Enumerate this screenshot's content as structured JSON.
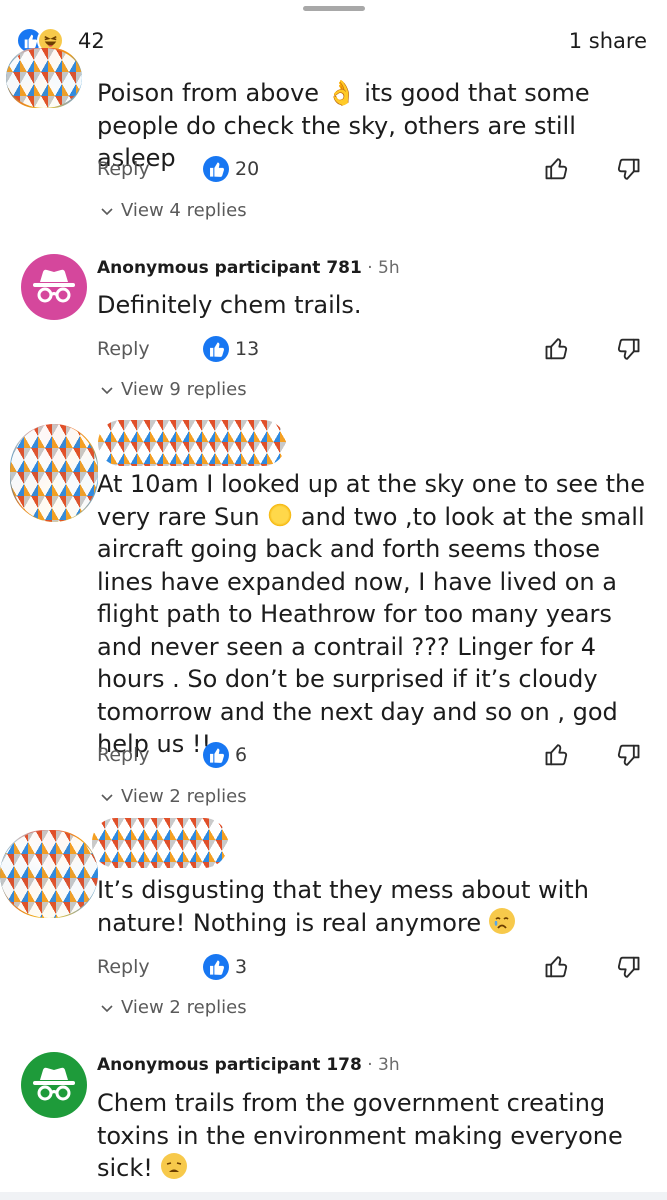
{
  "header": {
    "reaction_count": "42",
    "share_text": "1 share"
  },
  "comments": [
    {
      "body": "Poison from above 👌 its good that some people do check the sky, others are still asleep",
      "reply_label": "Reply",
      "likes": "20",
      "view_replies": "View 4 replies"
    },
    {
      "author": "Anonymous participant 781",
      "time": "· 5h",
      "body": "Definitely chem trails.",
      "reply_label": "Reply",
      "likes": "13",
      "view_replies": "View 9 replies",
      "avatar_color": "#d5479c"
    },
    {
      "body_part1": "At 10am I looked up at the sky one to see the very rare Sun",
      "body_part2": " and two ,to look at the small aircraft going back and forth seems those lines have expanded now,  I have lived on a flight path to Heathrow for too many years  and never seen a contrail ??? Linger for 4 hours . So don’t be surprised if it’s cloudy tomorrow and the next day and so on , god help us !!",
      "reply_label": "Reply",
      "likes": "6",
      "view_replies": "View 2 replies"
    },
    {
      "body": "It’s disgusting that they mess about with nature! Nothing is real anymore",
      "reply_label": "Reply",
      "likes": "3",
      "view_replies": "View 2 replies"
    },
    {
      "author": "Anonymous participant 178",
      "time": "· 3h",
      "body": "Chem trails from the government creating toxins in the environment making everyone sick!",
      "avatar_color": "#1e9b3a"
    }
  ],
  "colors": {
    "like_blue": "#1877f2",
    "text": "#1c1c1c",
    "secondary_text": "#5a5a5a"
  },
  "icons": [
    "like-icon",
    "haha-icon",
    "thumb-up-icon",
    "thumb-down-icon",
    "chevron-down-icon",
    "anonymous-icon"
  ]
}
